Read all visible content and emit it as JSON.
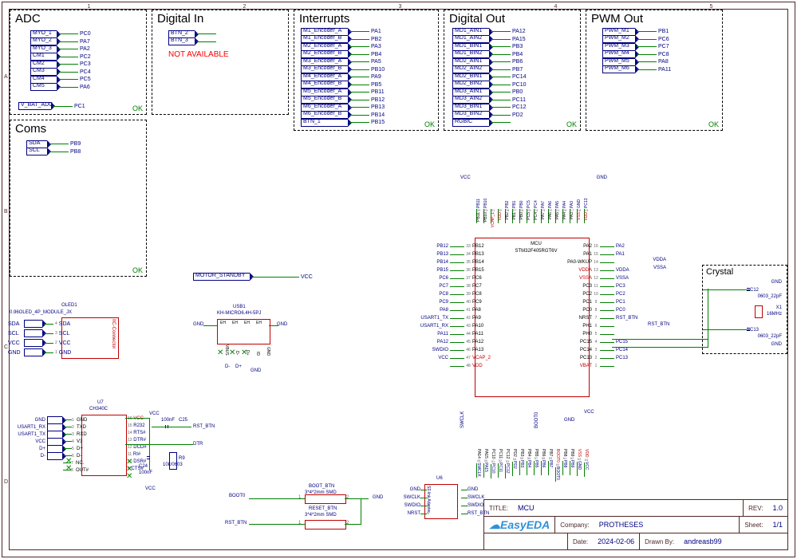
{
  "ruler_top": [
    "1",
    "2",
    "3",
    "4",
    "5"
  ],
  "ruler_left": [
    "A",
    "B",
    "C",
    "D"
  ],
  "blocks": {
    "adc": {
      "title": "ADC",
      "ok": "OK",
      "rows": [
        {
          "name": "MYO_1",
          "pin": "PC0"
        },
        {
          "name": "MYO_2",
          "pin": "PA7"
        },
        {
          "name": "MYO_3",
          "pin": "PA2"
        },
        {
          "name": "CM1",
          "pin": "PC2"
        },
        {
          "name": "CM2",
          "pin": "PC3"
        },
        {
          "name": "CM3",
          "pin": "PC4"
        },
        {
          "name": "CM4",
          "pin": "PC5"
        },
        {
          "name": "CM5",
          "pin": "PA6"
        }
      ],
      "extra": {
        "name": "V_BAT_ADC",
        "pin": "PC1"
      }
    },
    "din": {
      "title": "Digital In",
      "rows": [
        {
          "name": "BTN_2",
          "pin": ""
        },
        {
          "name": "BTN_3",
          "pin": ""
        }
      ],
      "warn": "NOT AVAILABLE"
    },
    "interrupts": {
      "title": "Interrupts",
      "ok": "OK",
      "rows": [
        {
          "name": "M1_Encoder_A",
          "pin": "PA1"
        },
        {
          "name": "M1_Encoder_B",
          "pin": "PB2"
        },
        {
          "name": "M2_Encoder_A",
          "pin": "PA3"
        },
        {
          "name": "M2_Encoder_B",
          "pin": "PB4"
        },
        {
          "name": "M3_Encoder_A",
          "pin": "PA5"
        },
        {
          "name": "M3_Encoder_B",
          "pin": "PB10"
        },
        {
          "name": "M4_Encoder_A",
          "pin": "PA9"
        },
        {
          "name": "M4_Encoder_B",
          "pin": "PB5"
        },
        {
          "name": "M5_Encoder_A",
          "pin": "PB11"
        },
        {
          "name": "M5_Encoder_B",
          "pin": "PB12"
        },
        {
          "name": "M6_Encoder_A",
          "pin": "PB13"
        },
        {
          "name": "M6_Encoder_B",
          "pin": "PB14"
        },
        {
          "name": "BTN_1",
          "pin": "PB15"
        }
      ]
    },
    "dout": {
      "title": "Digital Out",
      "ok": "OK",
      "rows": [
        {
          "name": "MD1_AIN1",
          "pin": "PA12"
        },
        {
          "name": "MD1_AIN2",
          "pin": "PA15"
        },
        {
          "name": "MD1_BIN1",
          "pin": "PB3"
        },
        {
          "name": "MD1_BIN2",
          "pin": "PB4"
        },
        {
          "name": "MD2_AIN1",
          "pin": "PB6"
        },
        {
          "name": "MD2_AIN2",
          "pin": "PB7"
        },
        {
          "name": "MD2_BIN1",
          "pin": "PC14"
        },
        {
          "name": "MD2_BIN2",
          "pin": "PC10"
        },
        {
          "name": "MD3_AIN1",
          "pin": "PB0"
        },
        {
          "name": "MD3_AIN2",
          "pin": "PC11"
        },
        {
          "name": "MD3_BIN1",
          "pin": "PC12"
        },
        {
          "name": "MD3_BIN2",
          "pin": "PD2"
        },
        {
          "name": "RGBIC",
          "pin": ""
        }
      ]
    },
    "pwm": {
      "title": "PWM Out",
      "ok": "OK",
      "rows": [
        {
          "name": "PWM_M1",
          "pin": "PB1"
        },
        {
          "name": "PWM_M2",
          "pin": "PC6"
        },
        {
          "name": "PWM_M3",
          "pin": "PC7"
        },
        {
          "name": "PWM_M4",
          "pin": "PC8"
        },
        {
          "name": "PWM_M5",
          "pin": "PA8"
        },
        {
          "name": "PWM_M6",
          "pin": "PA11"
        }
      ]
    },
    "coms": {
      "title": "Coms",
      "ok": "OK",
      "rows": [
        {
          "name": "SDA",
          "pin": "PB9"
        },
        {
          "name": "SCL",
          "pin": "PB8"
        }
      ]
    }
  },
  "motor_standby": {
    "name": "MOTOR_STANDBY",
    "net": "VCC"
  },
  "crystal": {
    "title": "Crystal",
    "c12": "C12",
    "c12v": "0603_22pF",
    "c13": "C13",
    "c13v": "0603_22pF",
    "x1": "X1",
    "x1v": "16MHz",
    "gnd": "GND"
  },
  "oled": {
    "ref": "OLED1",
    "name": "0.96OLED_4P_MODULE_JX",
    "side": "IIC-Connector",
    "pins": [
      "SDA",
      "SCL",
      "VCC",
      "GND"
    ],
    "labels": [
      "SDA",
      "SCL",
      "VCC",
      "GND"
    ],
    "nums": [
      "4",
      "3",
      "2",
      "1"
    ]
  },
  "usb": {
    "ref": "USB1",
    "name": "KH-MICRO6.4H-5PJ",
    "pins_top": [
      "EH",
      "EH",
      "EH",
      "EH"
    ],
    "pins_bot": [
      "VBUS",
      "D-",
      "D+",
      "ID",
      "GND"
    ],
    "gnd": "GND",
    "dm": "D-",
    "dp": "D+"
  },
  "ch340": {
    "ref": "U7",
    "name": "CH340C",
    "left": [
      "GND",
      "TXD",
      "RXD",
      "V3",
      "D+",
      "D-",
      "NC.",
      "OUT#"
    ],
    "right": [
      "VCC",
      "R232",
      "RTS#",
      "DTR#",
      "DCD#",
      "RI#",
      "DSR#",
      "CTS#"
    ],
    "nets_left": [
      "GND",
      "USART1_RX",
      "USART1_TX",
      "VCC",
      "D+",
      "D-",
      "",
      ""
    ],
    "nums_left": [
      "1",
      "2",
      "3",
      "4",
      "5",
      "6",
      "7",
      "8"
    ],
    "nums_right": [
      "16",
      "15",
      "14",
      "13",
      "12",
      "11",
      "10",
      "9"
    ],
    "vcc": "VCC",
    "c24": "C24",
    "c24v": "100nF",
    "c25": "C25",
    "c25v": "100nF",
    "r9": "R9",
    "r9v": "10k/0603",
    "rst": "RST_BTN",
    "dtr": "DTR"
  },
  "buttons": {
    "boot_ref": "BOOT_BTN",
    "boot_name": "3*4*2mm SMD",
    "boot_net": "BOOT0",
    "reset_ref": "RESET_BTN",
    "reset_name": "3*4*2mm SMD",
    "reset_net": "RST_BTN",
    "gnd": "GND",
    "nums": [
      "1",
      "2"
    ]
  },
  "swd": {
    "ref": "U6",
    "name": "ST-link Adapter",
    "right": [
      "GND",
      "SWCLK",
      "SWDIO",
      "RST_BTN"
    ],
    "left": [
      "GND",
      "SWCLK",
      "SWDIO",
      "NRST"
    ],
    "nums": [
      "1",
      "2",
      "3",
      "4"
    ]
  },
  "mcu": {
    "ref": "MCU",
    "part": "STM32F405RGT6V",
    "vcc": "VCC",
    "gnd": "GND",
    "vdda": "VDDA",
    "vssa": "VSSA",
    "left_pins": [
      {
        "n": "33",
        "name": "PB12",
        "net": "PB12"
      },
      {
        "n": "34",
        "name": "PB13",
        "net": "PB13"
      },
      {
        "n": "35",
        "name": "PB14",
        "net": "PB14"
      },
      {
        "n": "36",
        "name": "PB15",
        "net": "PB15"
      },
      {
        "n": "37",
        "name": "PC6",
        "net": "PC6"
      },
      {
        "n": "38",
        "name": "PC7",
        "net": "PC7"
      },
      {
        "n": "39",
        "name": "PC8",
        "net": "PC8"
      },
      {
        "n": "40",
        "name": "PC9",
        "net": "PC9"
      },
      {
        "n": "41",
        "name": "PA8",
        "net": "PA8"
      },
      {
        "n": "42",
        "name": "PA9",
        "net": "USART1_TX"
      },
      {
        "n": "43",
        "name": "PA10",
        "net": "USART1_RX"
      },
      {
        "n": "44",
        "name": "PA11",
        "net": "PA11"
      },
      {
        "n": "45",
        "name": "PA12",
        "net": "PA12"
      },
      {
        "n": "46",
        "name": "PA13",
        "net": "SWDIO"
      },
      {
        "n": "47",
        "name": "VCAP_2",
        "net": "VCC"
      },
      {
        "n": "48",
        "name": "VDD",
        "net": ""
      }
    ],
    "right_pins": [
      {
        "n": "16",
        "name": "PA2",
        "net": "PA2"
      },
      {
        "n": "15",
        "name": "PA1",
        "net": "PA1"
      },
      {
        "n": "14",
        "name": "PA0-WKUP",
        "net": ""
      },
      {
        "n": "13",
        "name": "VDDA",
        "net": "VDDA"
      },
      {
        "n": "12",
        "name": "VSSA",
        "net": "VSSA"
      },
      {
        "n": "11",
        "name": "PC3",
        "net": "PC3"
      },
      {
        "n": "10",
        "name": "PC2",
        "net": "PC2"
      },
      {
        "n": "9",
        "name": "PC1",
        "net": "PC1"
      },
      {
        "n": "8",
        "name": "PC0",
        "net": "PC0"
      },
      {
        "n": "7",
        "name": "NRST",
        "net": "RST_BTN"
      },
      {
        "n": "6",
        "name": "PH1",
        "net": ""
      },
      {
        "n": "5",
        "name": "PH0",
        "net": ""
      },
      {
        "n": "4",
        "name": "PC15",
        "net": "PC15"
      },
      {
        "n": "3",
        "name": "PC14",
        "net": "PC14"
      },
      {
        "n": "2",
        "name": "PC13",
        "net": "PC13"
      },
      {
        "n": "1",
        "name": "VBAT",
        "net": ""
      }
    ],
    "top_pins": [
      "PB11",
      "PB10",
      "VCAP_1",
      "VDD",
      "PB2",
      "PB1",
      "PB0",
      "PC5",
      "PC4",
      "PA7",
      "PA6",
      "PA5",
      "PA4",
      "PA3",
      "VSS",
      "VDD"
    ],
    "top_nums": [
      "30",
      "29",
      "31",
      "32",
      "28",
      "27",
      "26",
      "25",
      "24",
      "23",
      "22",
      "21",
      "20",
      "17",
      "18",
      "19"
    ],
    "top_nets": [
      "PB11",
      "PB10",
      "",
      "",
      "PB2",
      "PB1",
      "PB0",
      "PC5",
      "PC4",
      "PA7",
      "PA6",
      "PA5",
      "PA4",
      "PA3",
      "GND",
      "PC13"
    ],
    "bot_pins": [
      "PA14",
      "PA15",
      "PC10",
      "PC11",
      "PC12",
      "PD2",
      "PB3",
      "PB4",
      "PB5",
      "PB6",
      "PB7",
      "BOOT0",
      "PB8",
      "PB9",
      "VSS",
      "VDD"
    ],
    "bot_nums": [
      "49",
      "50",
      "51",
      "52",
      "53",
      "54",
      "55",
      "56",
      "57",
      "58",
      "59",
      "60",
      "61",
      "62",
      "63",
      "64"
    ],
    "bot_nets": [
      "SWCLK",
      "PA15",
      "PC10",
      "PC11",
      "PC12",
      "PD2",
      "PB3",
      "PB4",
      "PB5",
      "PB6",
      "PB7",
      "BOOT0",
      "PB8",
      "PB9",
      "GND",
      "VCC"
    ]
  },
  "titleblock": {
    "title_label": "TITLE:",
    "title": "MCU",
    "rev_label": "REV:",
    "rev": "1.0",
    "company_label": "Company:",
    "company": "PROTHESES",
    "sheet_label": "Sheet:",
    "sheet": "1/1",
    "date_label": "Date:",
    "date": "2024-02-06",
    "drawn_label": "Drawn By:",
    "drawn": "andreasb99",
    "logo": "EasyEDA"
  }
}
